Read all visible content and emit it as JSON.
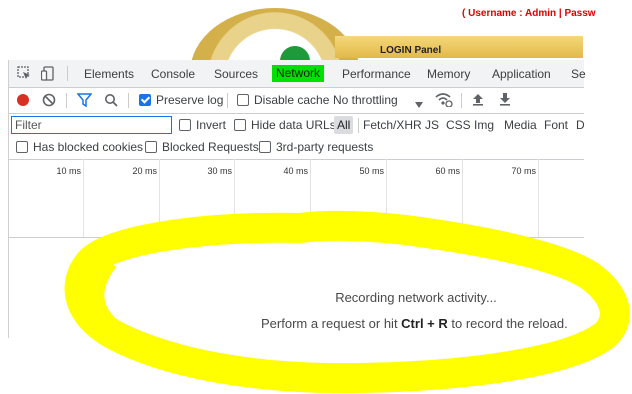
{
  "page": {
    "credentials": "( Username : Admin | Passw",
    "login_title": "LOGIN Panel"
  },
  "tabs": [
    {
      "label": "Elements"
    },
    {
      "label": "Console"
    },
    {
      "label": "Sources"
    },
    {
      "label": "Network",
      "active": true
    },
    {
      "label": "Performance"
    },
    {
      "label": "Memory"
    },
    {
      "label": "Application"
    },
    {
      "label": "Se"
    }
  ],
  "toolbar": {
    "preserve_log": "Preserve log",
    "disable_cache": "Disable cache",
    "throttling": "No throttling"
  },
  "filter": {
    "placeholder": "Filter",
    "invert": "Invert",
    "hide_data_urls": "Hide data URLs",
    "types": [
      "All",
      "Fetch/XHR",
      "JS",
      "CSS",
      "Img",
      "Media",
      "Font",
      "D"
    ]
  },
  "options": {
    "blocked_cookies": "Has blocked cookies",
    "blocked_requests": "Blocked Requests",
    "third_party": "3rd-party requests"
  },
  "timeline": {
    "ticks": [
      "10 ms",
      "20 ms",
      "30 ms",
      "40 ms",
      "50 ms",
      "60 ms",
      "70 ms"
    ]
  },
  "empty_state": {
    "recording": "Recording network activity...",
    "hint_prefix": "Perform a request or hit ",
    "hint_keys": "Ctrl + R",
    "hint_suffix": " to record the reload."
  },
  "colors": {
    "active_tab_highlight": "#00e000",
    "annotation": "#ffff00",
    "record": "#d93025",
    "accent": "#1a73e8"
  },
  "icons": [
    "inspect-icon",
    "device-toggle-icon",
    "record-icon",
    "clear-icon",
    "filter-icon",
    "search-icon",
    "wifi-settings-icon",
    "upload-icon",
    "download-icon",
    "dropdown-arrow-icon"
  ]
}
